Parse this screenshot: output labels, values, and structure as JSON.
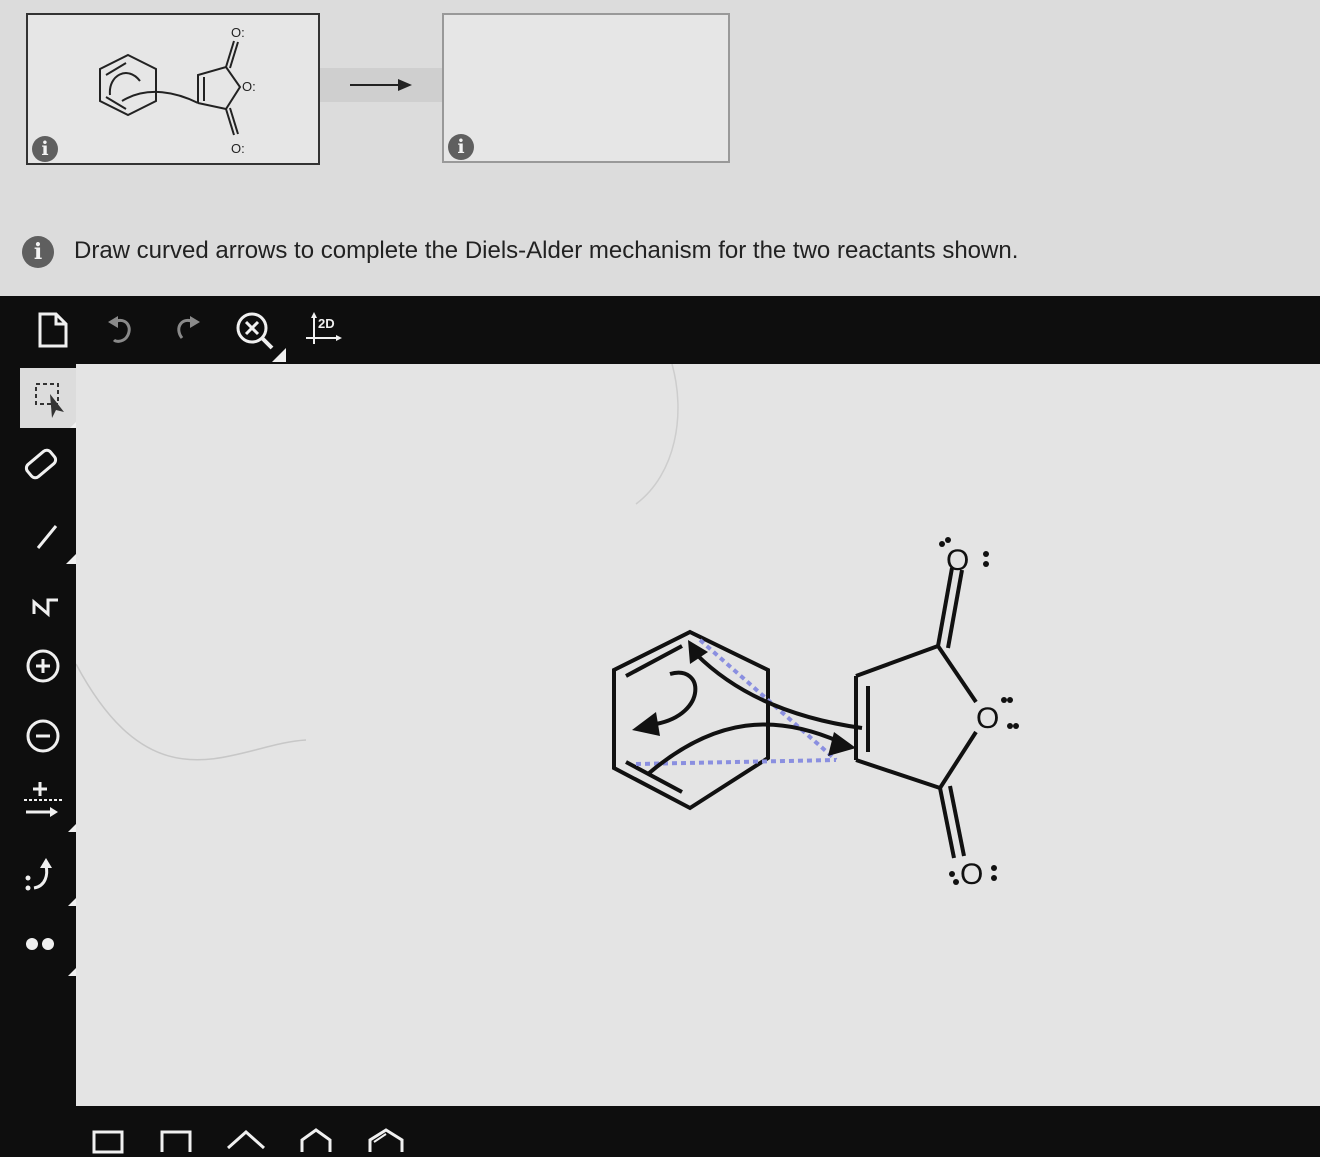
{
  "mechanism_panels": {
    "reactants_panel": {
      "info_icon": "i"
    },
    "product_panel": {
      "info_icon": "i"
    }
  },
  "instruction": {
    "info_icon": "i",
    "text": "Draw curved arrows to complete the Diels-Alder mechanism for the two reactants shown."
  },
  "top_toolbar": {
    "icons": [
      "new-document-icon",
      "undo-icon",
      "redo-icon",
      "clean-zoom-icon",
      "clean-2d-icon"
    ],
    "clean_2d_label": "2D"
  },
  "left_toolbar": {
    "icons": [
      "selection-icon",
      "eraser-icon",
      "bond-icon",
      "chain-icon",
      "positive-charge-icon",
      "negative-charge-icon",
      "electron-arrow-icon",
      "curved-arrow-icon",
      "lone-pair-icon"
    ],
    "selected": "selection-icon",
    "chain_label": "ʌ/"
  },
  "canvas": {
    "molecule_labels": {
      "o_top": "O",
      "o_ring": "O",
      "o_bottom": "O"
    }
  },
  "bottom_toolbar": {
    "templates": [
      "cyclopropane-icon",
      "cyclobutane-icon",
      "cyclopentane-icon",
      "cyclohexane-icon",
      "benzene-icon"
    ]
  },
  "colors": {
    "toolbar": "#0e0e0e",
    "canvas": "#e4e4e4",
    "icon": "#f0f0f0",
    "dashed_bond": "#8a8fe0"
  }
}
